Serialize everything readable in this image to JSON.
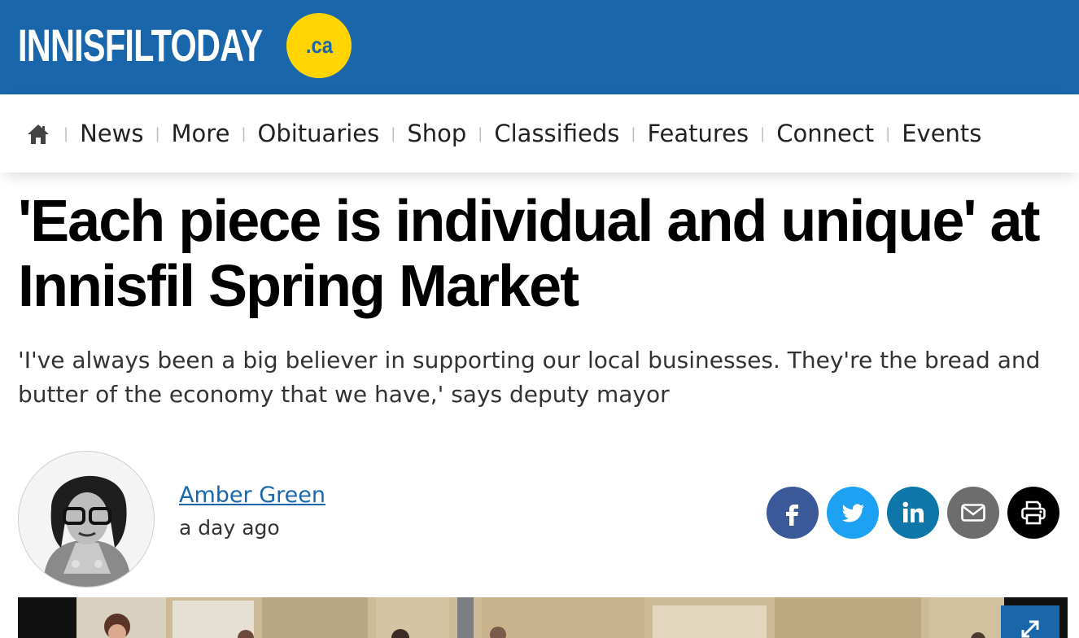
{
  "site": {
    "logo_text": "INNISFILTODAY",
    "logo_badge": ".ca",
    "header_color": "#1a66ab",
    "badge_color": "#ffd400"
  },
  "nav": {
    "home_icon": "home-icon",
    "items": [
      "News",
      "More",
      "Obituaries",
      "Shop",
      "Classifieds",
      "Features",
      "Connect",
      "Events"
    ]
  },
  "article": {
    "headline": "'Each piece is individual and unique' at Innisfil Spring Market",
    "subheadline": "'I've always been a big believer in supporting our local businesses. They're the bread and butter of the economy that we have,' says deputy mayor",
    "author": "Amber Green",
    "published": "a day ago"
  },
  "share": {
    "buttons": [
      {
        "name": "facebook",
        "icon": "facebook-icon",
        "color": "#3b5998"
      },
      {
        "name": "twitter",
        "icon": "twitter-icon",
        "color": "#1da1f2"
      },
      {
        "name": "linkedin",
        "icon": "linkedin-icon",
        "color": "#0e76a8"
      },
      {
        "name": "email",
        "icon": "email-icon",
        "color": "#6d6d6d"
      },
      {
        "name": "print",
        "icon": "print-icon",
        "color": "#000000"
      }
    ]
  },
  "photo": {
    "expand_icon": "expand-icon"
  }
}
